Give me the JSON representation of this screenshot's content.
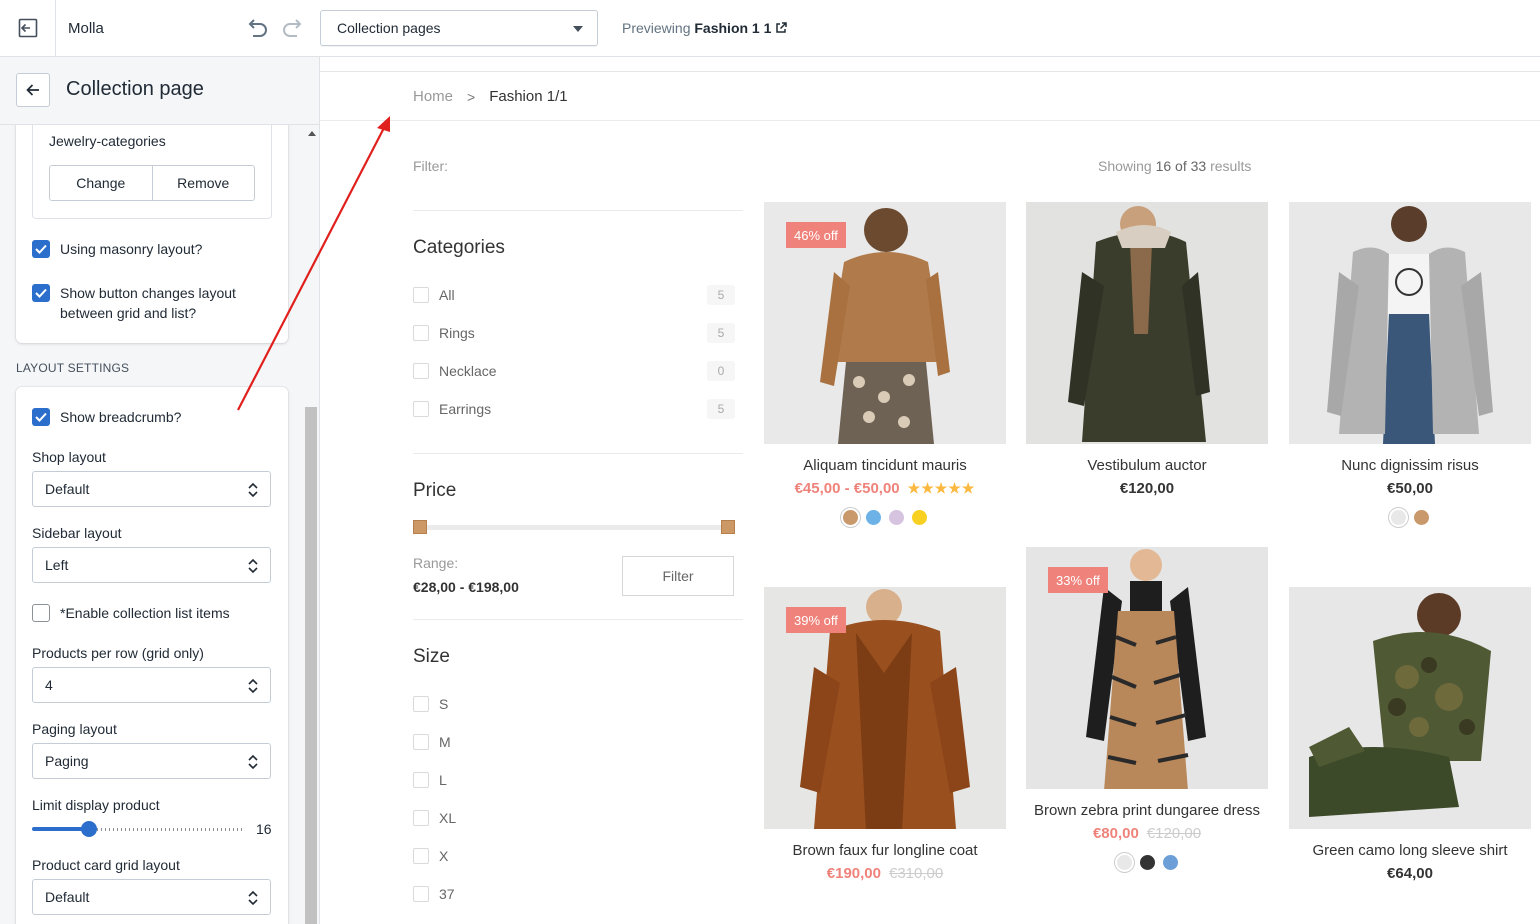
{
  "topbar": {
    "store_name": "Molla",
    "template_selected": "Collection pages",
    "preview_prefix": "Previewing",
    "preview_name": "Fashion 1 1"
  },
  "sidebar": {
    "title": "Collection page",
    "collection_handle": "Jewelry-categories",
    "change_label": "Change",
    "remove_label": "Remove",
    "masonry_label": "Using masonry layout?",
    "masonry_checked": true,
    "toggle_label_1": "Show button changes layout",
    "toggle_label_2": "between grid and list?",
    "toggle_checked": true,
    "section_heading": "LAYOUT SETTINGS",
    "breadcrumb_label": "Show breadcrumb?",
    "breadcrumb_checked": true,
    "shop_layout_label": "Shop layout",
    "shop_layout_value": "Default",
    "sidebar_layout_label": "Sidebar layout",
    "sidebar_layout_value": "Left",
    "enable_list_label": "*Enable collection list items",
    "enable_list_checked": false,
    "per_row_label": "Products per row (grid only)",
    "per_row_value": "4",
    "paging_label": "Paging layout",
    "paging_value": "Paging",
    "limit_label": "Limit display product",
    "limit_value": "16",
    "limit_fraction": 0.27,
    "card_layout_label": "Product card grid layout",
    "card_layout_value": "Default"
  },
  "preview": {
    "breadcrumb": {
      "home": "Home",
      "separator": ">",
      "current": "Fashion 1/1"
    },
    "filter_label": "Filter:",
    "results": {
      "prefix": "Showing",
      "shown": "16 of 33",
      "suffix": "results"
    },
    "categories_title": "Categories",
    "categories": [
      {
        "label": "All",
        "count": "5"
      },
      {
        "label": "Rings",
        "count": "5"
      },
      {
        "label": "Necklace",
        "count": "0"
      },
      {
        "label": "Earrings",
        "count": "5"
      }
    ],
    "price_title": "Price",
    "range_label": "Range:",
    "range_value": "€28,00 - €198,00",
    "filter_button": "Filter",
    "size_title": "Size",
    "sizes": [
      "S",
      "M",
      "L",
      "XL",
      "X",
      "37"
    ],
    "products": [
      {
        "name": "Aliquam tincidunt mauris",
        "price": "€45,00 - €50,00",
        "old_price": "",
        "badge": "46% off",
        "rating": "★★★★★",
        "swatches": [
          "#c9996b",
          "#6cb2e6",
          "#d5c3e0",
          "#f7d021"
        ]
      },
      {
        "name": "Vestibulum auctor",
        "price": "€120,00",
        "old_price": "",
        "badge": "",
        "rating": "",
        "swatches": []
      },
      {
        "name": "Nunc dignissim risus",
        "price": "€50,00",
        "old_price": "",
        "badge": "",
        "rating": "",
        "swatches": [
          "#e8e8e8",
          "#c9996b"
        ]
      },
      {
        "name": "Brown faux fur longline coat",
        "price": "€190,00",
        "old_price": "€310,00",
        "badge": "39% off",
        "rating": "",
        "swatches": []
      },
      {
        "name": "Brown zebra print dungaree dress",
        "price": "€80,00",
        "old_price": "€120,00",
        "badge": "33% off",
        "rating": "",
        "swatches": [
          "#e8e8e8",
          "#333333",
          "#6c9fd8"
        ]
      },
      {
        "name": "Green camo long sleeve shirt",
        "price": "€64,00",
        "old_price": "",
        "badge": "",
        "rating": "",
        "swatches": []
      }
    ]
  },
  "colors": {
    "accent_blue": "#2c6ecb",
    "sale_red": "#ef837b",
    "price_handle": "#cc9966",
    "annotation_arrow": "#e0201c"
  }
}
